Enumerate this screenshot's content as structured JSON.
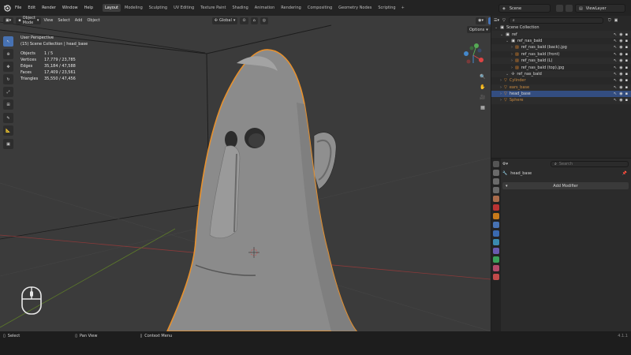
{
  "menu": [
    "File",
    "Edit",
    "Render",
    "Window",
    "Help"
  ],
  "workspaces": [
    "Layout",
    "Modeling",
    "Sculpting",
    "UV Editing",
    "Texture Paint",
    "Shading",
    "Animation",
    "Rendering",
    "Compositing",
    "Geometry Nodes",
    "Scripting"
  ],
  "scene": "Scene",
  "view_layer": "ViewLayer",
  "viewport": {
    "mode": "Object Mode",
    "menus": [
      "View",
      "Select",
      "Add",
      "Object"
    ],
    "transform": "Global",
    "options": "Options",
    "overlay": {
      "title": "User Perspective",
      "subtitle": "(15) Scene Collection | head_base",
      "stats": [
        {
          "k": "Objects",
          "v": "1 / 5"
        },
        {
          "k": "Vertices",
          "v": "17,779 / 23,785"
        },
        {
          "k": "Edges",
          "v": "35,184 / 47,588"
        },
        {
          "k": "Faces",
          "v": "17,409 / 23,561"
        },
        {
          "k": "Triangles",
          "v": "35,550 / 47,456"
        }
      ]
    }
  },
  "outliner": {
    "items": [
      {
        "label": "Scene Collection",
        "indent": 0,
        "type": "collection"
      },
      {
        "label": "ref",
        "indent": 1,
        "type": "collection"
      },
      {
        "label": "ref_nas_bald",
        "indent": 2,
        "type": "collection"
      },
      {
        "label": "ref_nas_bald (back).jpg",
        "indent": 3,
        "type": "image"
      },
      {
        "label": "ref_nas_bald (front)",
        "indent": 3,
        "type": "image"
      },
      {
        "label": "ref_nas_bald (L)",
        "indent": 3,
        "type": "image"
      },
      {
        "label": "ref_nas_bald (top).jpg",
        "indent": 3,
        "type": "image"
      },
      {
        "label": "ref_nas_bald",
        "indent": 2,
        "type": "empty"
      },
      {
        "label": "Cylinder",
        "indent": 1,
        "type": "mesh"
      },
      {
        "label": "ears_base",
        "indent": 1,
        "type": "mesh"
      },
      {
        "label": "head_base",
        "indent": 1,
        "type": "mesh",
        "selected": true
      },
      {
        "label": "Sphere",
        "indent": 1,
        "type": "mesh"
      }
    ]
  },
  "properties": {
    "search_placeholder": "Search",
    "object_name": "head_base",
    "add_modifier": "Add Modifier"
  },
  "status": {
    "select": "Select",
    "pan": "Pan View",
    "context": "Context Menu",
    "version": "4.1.1"
  },
  "colors": {
    "accent": "#4772b3",
    "selection_outline": "#e8912d",
    "viewport_bg": "#3b3b3b"
  }
}
